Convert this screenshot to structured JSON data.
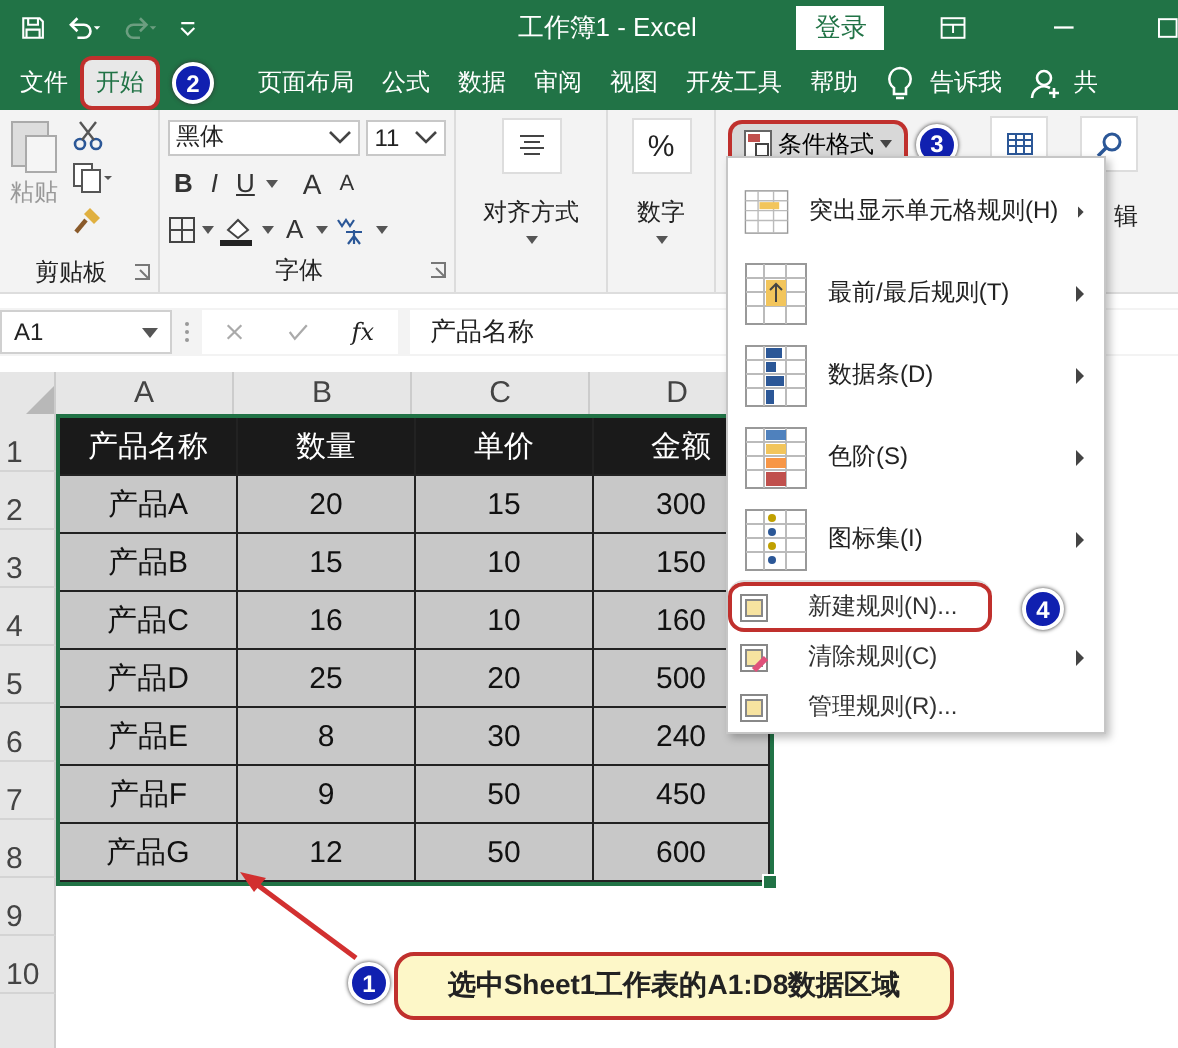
{
  "title_bar": {
    "title": "工作簿1 - Excel",
    "login_button": "登录"
  },
  "tabs": [
    {
      "label": "文件",
      "selected": false,
      "highlighted": false
    },
    {
      "label": "开始",
      "selected": true,
      "highlighted": true,
      "step": "2"
    },
    {
      "label": "页面布局",
      "selected": false,
      "highlighted": false
    },
    {
      "label": "公式",
      "selected": false,
      "highlighted": false
    },
    {
      "label": "数据",
      "selected": false,
      "highlighted": false
    },
    {
      "label": "审阅",
      "selected": false,
      "highlighted": false
    },
    {
      "label": "视图",
      "selected": false,
      "highlighted": false
    },
    {
      "label": "开发工具",
      "selected": false,
      "highlighted": false
    },
    {
      "label": "帮助",
      "selected": false,
      "highlighted": false
    }
  ],
  "tell_me": "告诉我",
  "share": "共",
  "ribbon": {
    "clipboard": {
      "paste": "粘贴",
      "label": "剪贴板"
    },
    "font": {
      "name": "黑体",
      "size": "11",
      "bold": "B",
      "italic": "I",
      "underline": "U",
      "grow": "A",
      "shrink": "A",
      "font_color_letter": "A",
      "label": "字体"
    },
    "alignment": "对齐方式",
    "number_symbol": "%",
    "number": "数字",
    "conditional_format": {
      "label": "条件格式",
      "highlighted": true,
      "step": "3"
    },
    "editing": "辑"
  },
  "formula_bar": {
    "name_box": "A1",
    "fx": "fx",
    "value": "产品名称"
  },
  "sheet": {
    "columns": [
      "A",
      "B",
      "C",
      "D"
    ],
    "row_numbers": [
      "1",
      "2",
      "3",
      "4",
      "5",
      "6",
      "7",
      "8",
      "9",
      "10"
    ],
    "header": [
      "产品名称",
      "数量",
      "单价",
      "金额"
    ],
    "rows": [
      [
        "产品A",
        "20",
        "15",
        "300"
      ],
      [
        "产品B",
        "15",
        "10",
        "150"
      ],
      [
        "产品C",
        "16",
        "10",
        "160"
      ],
      [
        "产品D",
        "25",
        "20",
        "500"
      ],
      [
        "产品E",
        "8",
        "30",
        "240"
      ],
      [
        "产品F",
        "9",
        "50",
        "450"
      ],
      [
        "产品G",
        "12",
        "50",
        "600"
      ]
    ]
  },
  "menu": {
    "items": [
      {
        "label": "突出显示单元格规则(H)",
        "kind": "large",
        "submenu": true,
        "highlighted": false
      },
      {
        "label": "最前/最后规则(T)",
        "kind": "large",
        "submenu": true,
        "highlighted": false
      },
      {
        "label": "数据条(D)",
        "kind": "large",
        "submenu": true,
        "highlighted": false
      },
      {
        "label": "色阶(S)",
        "kind": "large",
        "submenu": true,
        "highlighted": false
      },
      {
        "label": "图标集(I)",
        "kind": "large",
        "submenu": true,
        "highlighted": false
      },
      {
        "label": "新建规则(N)...",
        "kind": "small",
        "submenu": false,
        "highlighted": true,
        "step": "4"
      },
      {
        "label": "清除规则(C)",
        "kind": "small",
        "submenu": true,
        "highlighted": false
      },
      {
        "label": "管理规则(R)...",
        "kind": "small",
        "submenu": false,
        "highlighted": false
      }
    ]
  },
  "callout": {
    "step": "1",
    "text": "选中Sheet1工作表的A1:D8数据区域"
  }
}
